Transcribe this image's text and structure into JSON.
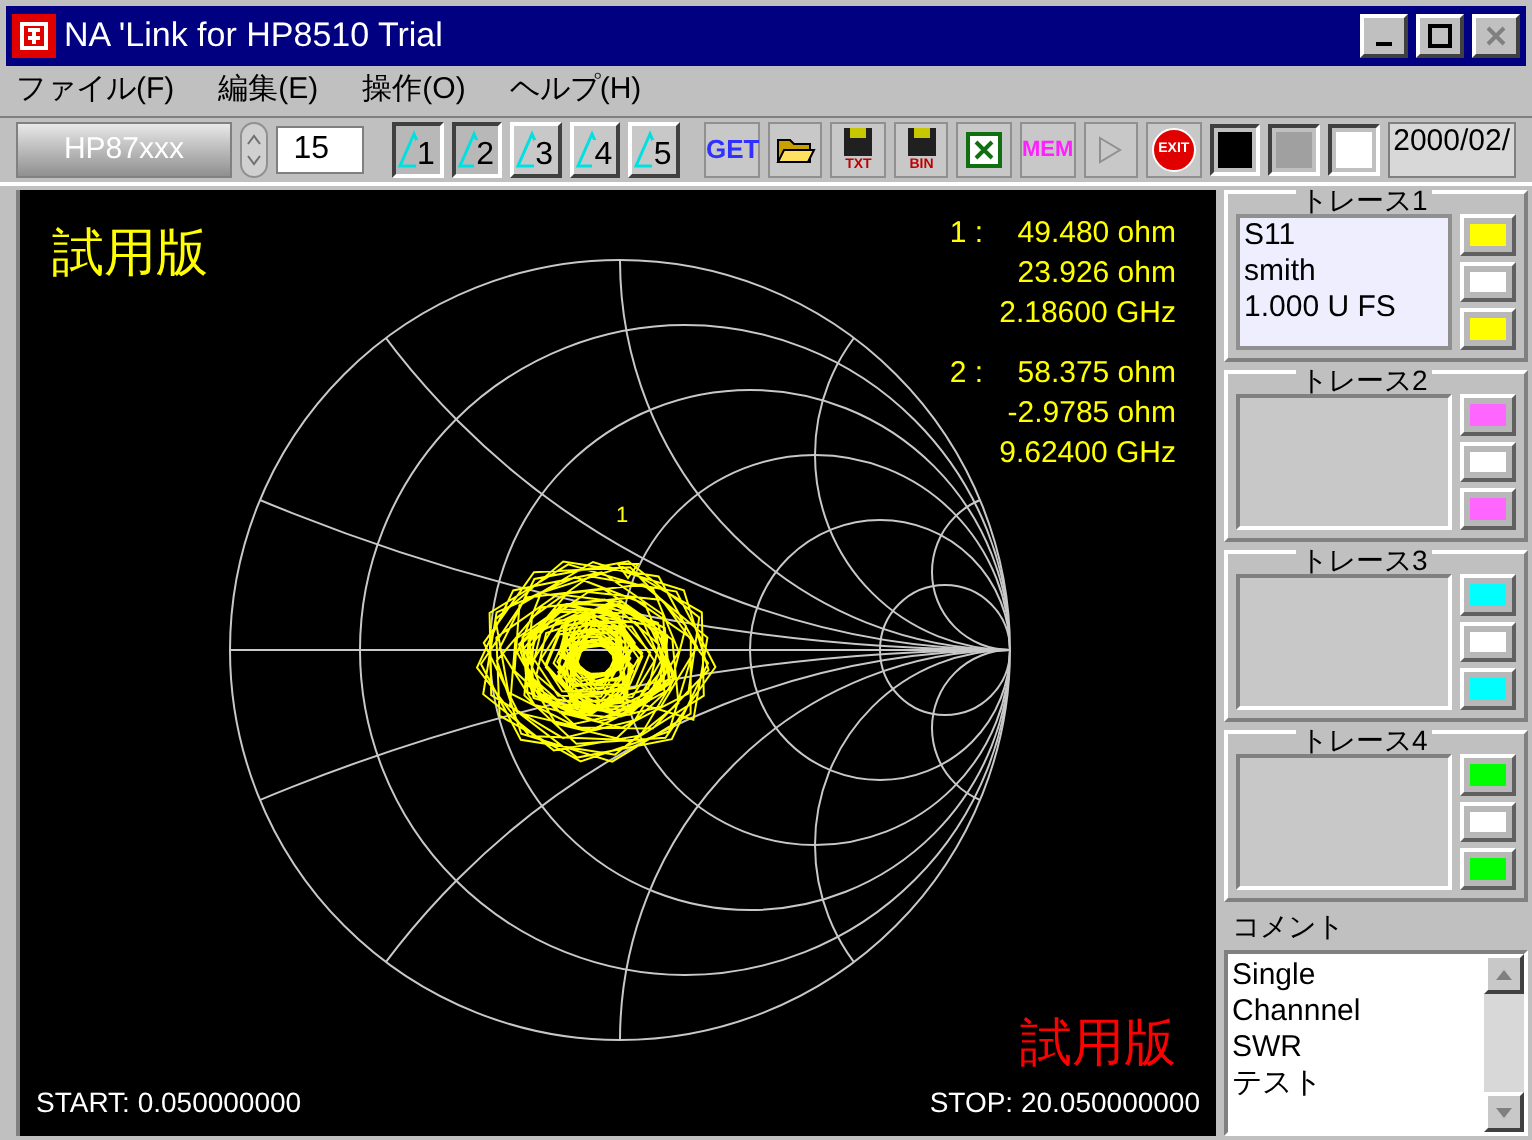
{
  "window": {
    "title": "NA 'Link for HP8510 Trial"
  },
  "menu": [
    "ファイル(F)",
    "編集(E)",
    "操作(O)",
    "ヘルプ(H)"
  ],
  "toolbar": {
    "model": "HP87xxx",
    "count": "15",
    "trace_buttons": [
      {
        "label": "1",
        "selected": true
      },
      {
        "label": "2",
        "selected": true
      },
      {
        "label": "3",
        "selected": false
      },
      {
        "label": "4",
        "selected": false
      },
      {
        "label": "5",
        "selected": false
      }
    ],
    "get": "GET",
    "mem": "MEM",
    "exit": "EXIT",
    "save_buttons": [
      "TXT",
      "BIN"
    ],
    "colors": [
      {
        "color": "#000000"
      },
      {
        "color": "#a0a0a0"
      },
      {
        "color": "#ffffff"
      }
    ],
    "date": "2000/02/"
  },
  "plot": {
    "watermark_top": "試用版",
    "watermark_bottom": "試用版",
    "markers": [
      {
        "label": "1 :",
        "lines": [
          "49.480 ohm",
          "23.926 ohm",
          "2.18600 GHz"
        ]
      },
      {
        "label": "2 :",
        "lines": [
          "58.375 ohm",
          "-2.9785 ohm",
          "9.62400 GHz"
        ]
      }
    ],
    "marker_flag": "1",
    "start": "START: 0.050000000",
    "stop": "STOP: 20.050000000"
  },
  "traces": [
    {
      "title": "トレース1",
      "lines": [
        "S11",
        "smith",
        "1.000 U FS"
      ],
      "swatches": [
        {
          "color": "#ffff00"
        },
        {
          "color": "#ffffff"
        },
        {
          "color": "#ffff00"
        }
      ]
    },
    {
      "title": "トレース2",
      "swatches": [
        {
          "color": "#ff66ff"
        },
        {
          "color": "#ffffff"
        },
        {
          "color": "#ff66ff"
        }
      ]
    },
    {
      "title": "トレース3",
      "swatches": [
        {
          "color": "#00ffff"
        },
        {
          "color": "#ffffff"
        },
        {
          "color": "#00ffff"
        }
      ]
    },
    {
      "title": "トレース4",
      "swatches": [
        {
          "color": "#00ff00"
        },
        {
          "color": "#ffffff"
        },
        {
          "color": "#00ff00"
        }
      ]
    }
  ],
  "comment": {
    "title": "コメント",
    "lines": [
      "Single",
      "Channnel",
      "SWR",
      "テスト"
    ]
  }
}
